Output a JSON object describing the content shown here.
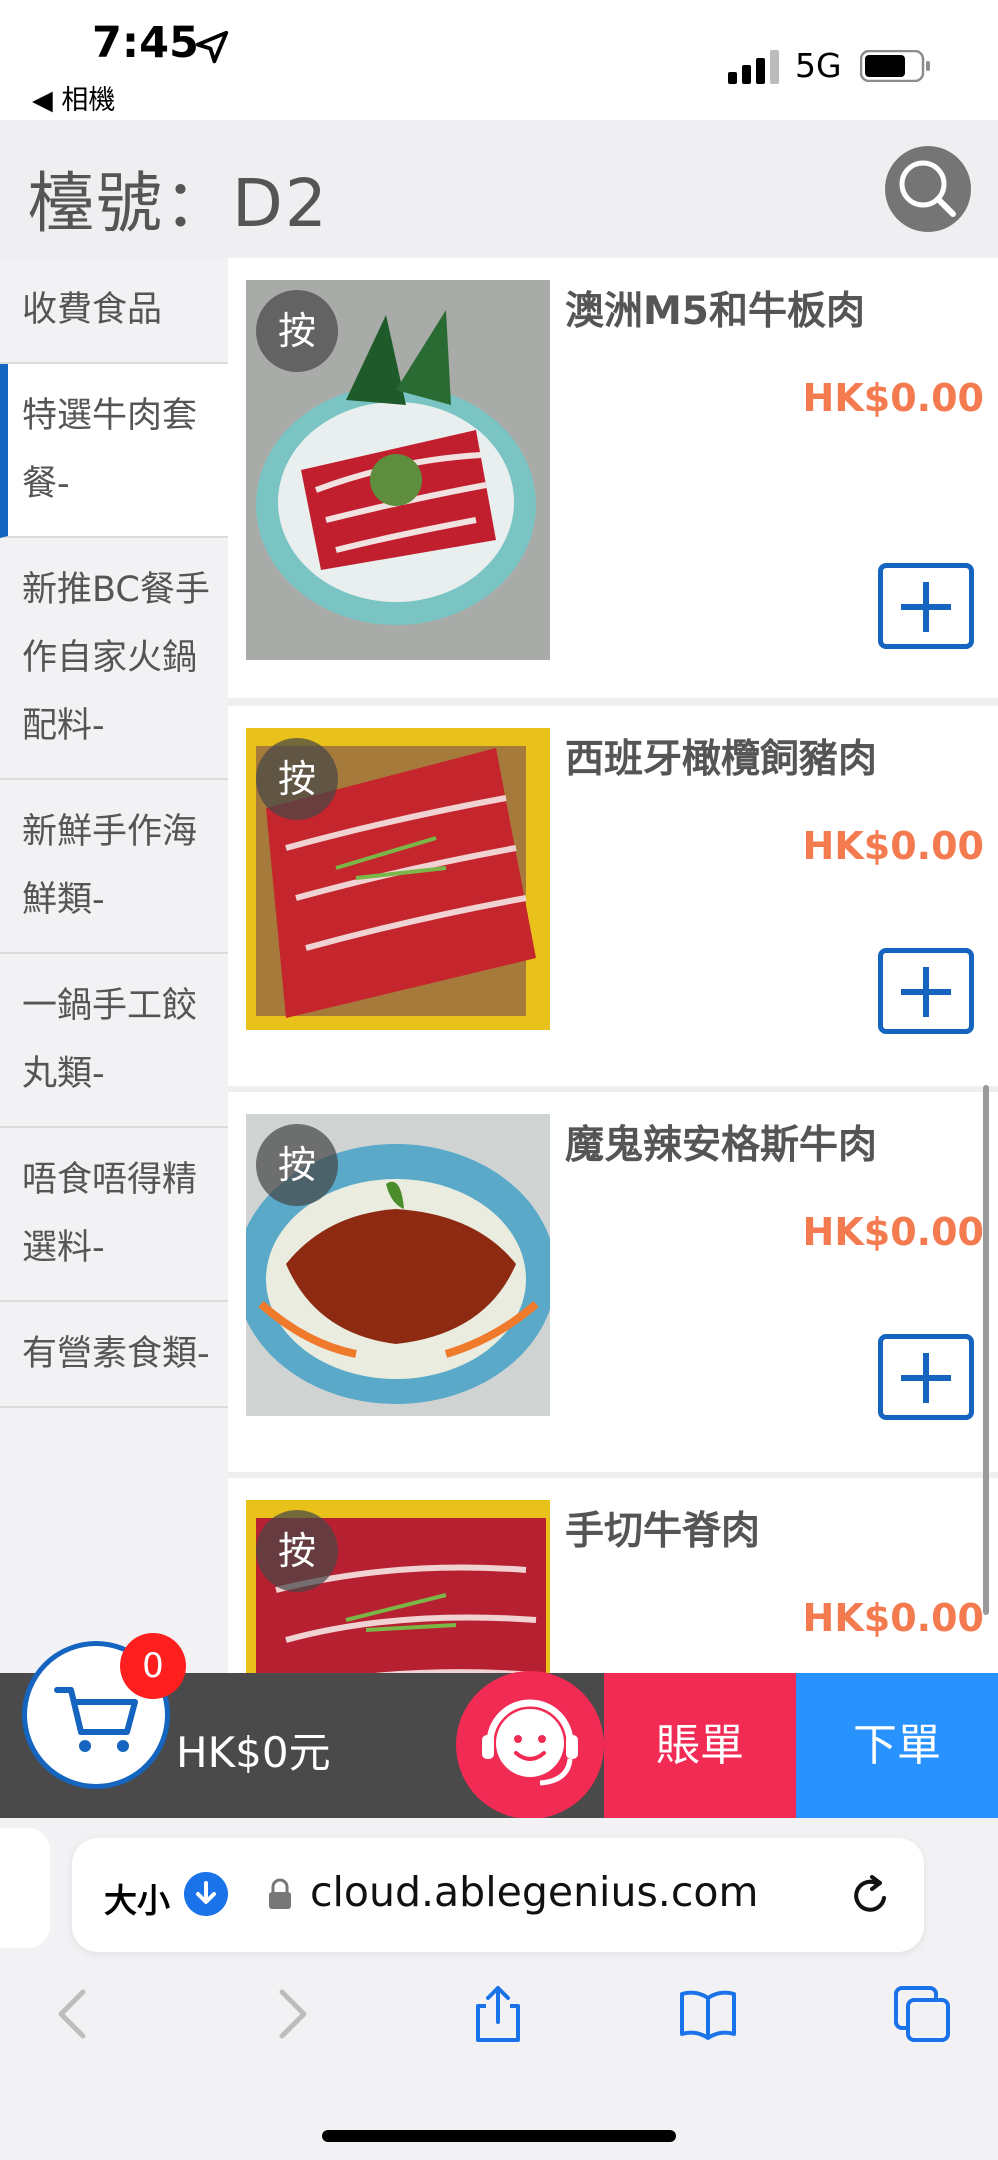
{
  "status_bar": {
    "time": "7:45",
    "back_app": "◀ 相機",
    "network": "5G"
  },
  "header": {
    "table_label": "檯號：D2",
    "search_icon": "search-icon"
  },
  "categories": [
    {
      "label": "收費食品",
      "active": false
    },
    {
      "label": "特選牛肉套餐-",
      "active": true
    },
    {
      "label": "新推BC餐手作自家火鍋配料-",
      "active": false
    },
    {
      "label": "新鮮手作海鮮類-",
      "active": false
    },
    {
      "label": "一鍋手工餃丸類-",
      "active": false
    },
    {
      "label": "唔食唔得精選料-",
      "active": false
    },
    {
      "label": "有營素食類-",
      "active": false
    }
  ],
  "products": [
    {
      "name": "澳洲M5和牛板肉",
      "price": "HK$0.00",
      "tag": "按"
    },
    {
      "name": "西班牙橄欖飼豬肉",
      "price": "HK$0.00",
      "tag": "按"
    },
    {
      "name": "魔鬼辣安格斯牛肉",
      "price": "HK$0.00",
      "tag": "按"
    },
    {
      "name": "手切牛脊肉",
      "price": "HK$0.00",
      "tag": "按"
    }
  ],
  "cart": {
    "count": "0",
    "total": "HK$0元"
  },
  "actions": {
    "bill": "賬單",
    "order": "下單"
  },
  "browser": {
    "text_size": "大小",
    "url": "cloud.ablegenius.com"
  },
  "colors": {
    "accent_blue": "#1565c0",
    "price_orange": "#f47a50",
    "bill_red": "#f22b55",
    "order_blue": "#2893ff"
  }
}
